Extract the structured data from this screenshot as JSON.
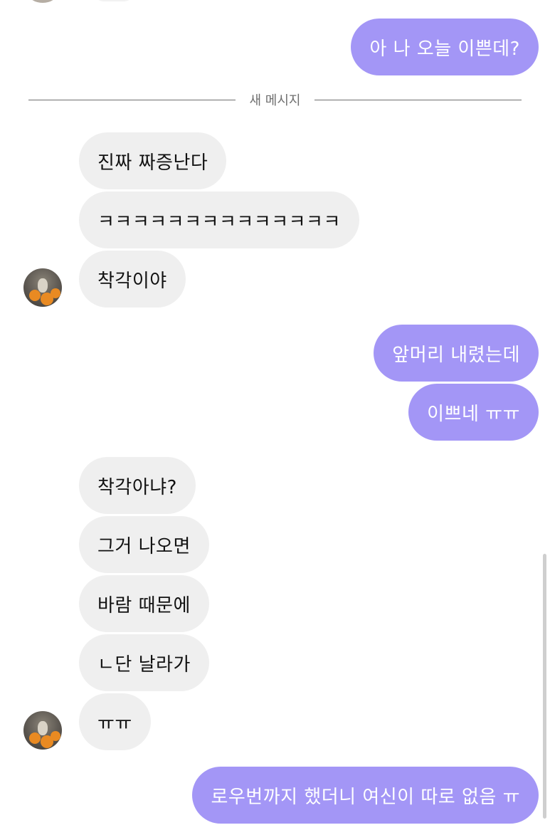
{
  "divider": {
    "label": "새 메시지"
  },
  "messages": [
    {
      "side": "out",
      "text": "아 나 오늘 이쁜데?"
    },
    {
      "side": "in",
      "text": "진짜 짜증난다"
    },
    {
      "side": "in",
      "text": "ㅋㅋㅋㅋㅋㅋㅋㅋㅋㅋㅋㅋㅋㅋ"
    },
    {
      "side": "in",
      "text": "착각이야"
    },
    {
      "side": "out",
      "text": "앞머리 내렸는데"
    },
    {
      "side": "out",
      "text": "이쁘네 ㅠㅠ"
    },
    {
      "side": "in",
      "text": "착각아냐?"
    },
    {
      "side": "in",
      "text": "그거 나오면"
    },
    {
      "side": "in",
      "text": "바람 때문에"
    },
    {
      "side": "in",
      "text": "ㄴ단 날라가"
    },
    {
      "side": "in",
      "text": "ㅠㅠ"
    },
    {
      "side": "out",
      "text": "로우번까지 했더니 여신이 따로 없음 ㅠ"
    }
  ],
  "colors": {
    "outgoing_bubble": "#a396f6",
    "incoming_bubble": "#efefef",
    "background": "#ffffff"
  }
}
